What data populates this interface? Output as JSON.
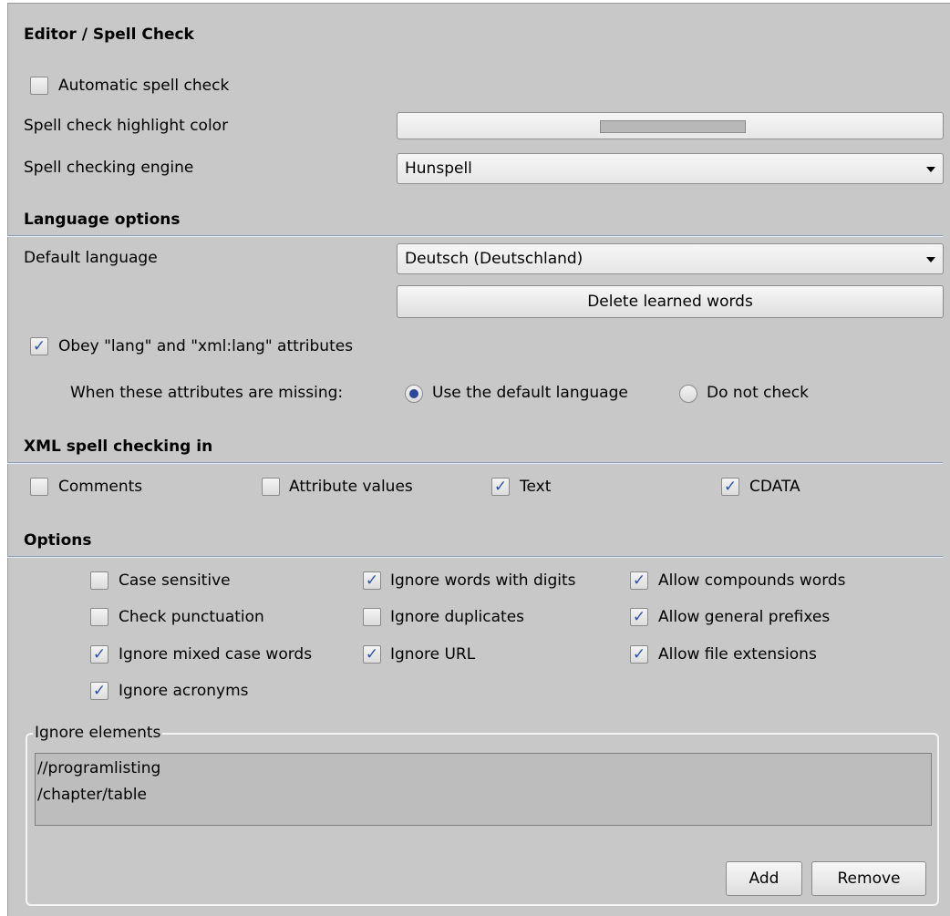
{
  "title": "Editor / Spell Check",
  "auto_spell": {
    "label": "Automatic spell check",
    "checked": false
  },
  "highlight": {
    "label": "Spell check highlight color",
    "color": "#b8b8b8"
  },
  "engine": {
    "label": "Spell checking engine",
    "value": "Hunspell"
  },
  "language_options": {
    "heading": "Language options",
    "default_language_label": "Default language",
    "default_language_value": "Deutsch (Deutschland)",
    "delete_learned_label": "Delete learned words",
    "obey_label": "Obey \"lang\" and \"xml:lang\" attributes",
    "obey_checked": true,
    "missing_label": "When these attributes are missing:",
    "radio_use_default": "Use the default language",
    "radio_do_not_check": "Do not check",
    "selected": "use_default"
  },
  "xml_spell": {
    "heading": "XML spell checking in",
    "items": [
      {
        "label": "Comments",
        "checked": false
      },
      {
        "label": "Attribute values",
        "checked": false
      },
      {
        "label": "Text",
        "checked": true
      },
      {
        "label": "CDATA",
        "checked": true
      }
    ]
  },
  "options": {
    "heading": "Options",
    "items": [
      {
        "label": "Case sensitive",
        "checked": false
      },
      {
        "label": "Ignore words with digits",
        "checked": true
      },
      {
        "label": "Allow compounds words",
        "checked": true
      },
      {
        "label": "Check punctuation",
        "checked": false
      },
      {
        "label": "Ignore duplicates",
        "checked": false
      },
      {
        "label": "Allow general prefixes",
        "checked": true
      },
      {
        "label": "Ignore mixed case words",
        "checked": true
      },
      {
        "label": "Ignore URL",
        "checked": true
      },
      {
        "label": "Allow file extensions",
        "checked": true
      },
      {
        "label": "Ignore acronyms",
        "checked": true
      }
    ]
  },
  "ignore_elements": {
    "legend": "Ignore elements",
    "entries": [
      "//programlisting",
      "/chapter/table"
    ],
    "add_label": "Add",
    "remove_label": "Remove"
  },
  "colors": {
    "panel_bg": "#c8c8c8",
    "check_mark": "#2f52a6",
    "separator": "#8da0b8"
  }
}
